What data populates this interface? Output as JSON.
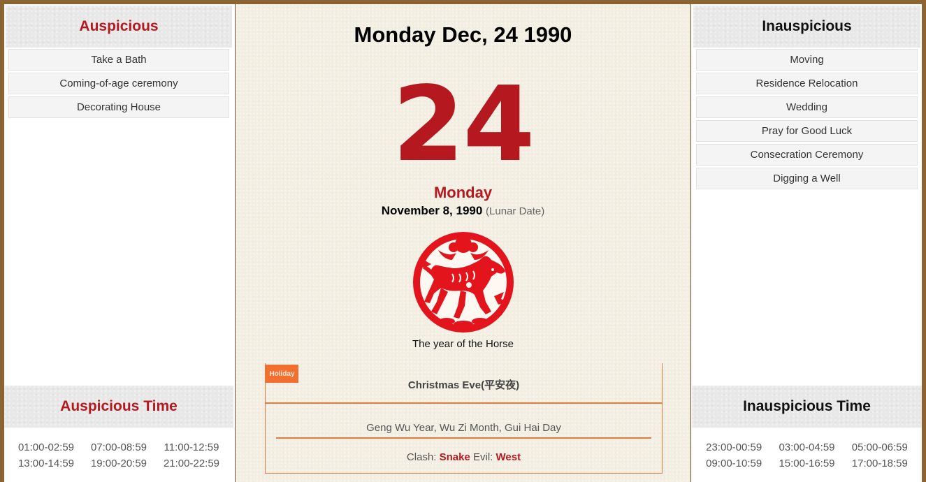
{
  "auspicious": {
    "title": "Auspicious",
    "items": [
      "Take a Bath",
      "Coming-of-age ceremony",
      "Decorating House"
    ]
  },
  "inauspicious": {
    "title": "Inauspicious",
    "items": [
      "Moving",
      "Residence Relocation",
      "Wedding",
      "Pray for Good Luck",
      "Consecration Ceremony",
      "Digging a Well"
    ]
  },
  "auspicious_time": {
    "title": "Auspicious Time",
    "slots": [
      "01:00-02:59",
      "07:00-08:59",
      "11:00-12:59",
      "13:00-14:59",
      "19:00-20:59",
      "21:00-22:59"
    ]
  },
  "inauspicious_time": {
    "title": "Inauspicious Time",
    "slots": [
      "23:00-00:59",
      "03:00-04:59",
      "05:00-06:59",
      "09:00-10:59",
      "15:00-16:59",
      "17:00-18:59"
    ]
  },
  "center": {
    "date_title": "Monday Dec, 24 1990",
    "day_number": "24",
    "weekday": "Monday",
    "lunar_date": "November 8, 1990",
    "lunar_label": "(Lunar Date)",
    "zodiac_icon": "horse-papercut-icon",
    "zodiac_caption": "The year of the Horse",
    "holiday_badge": "Holiday",
    "holiday_name": "Christmas Eve(平安夜)",
    "ganzhi": "Geng Wu Year, Wu Zi Month, Gui Hai Day",
    "clash_label": "Clash:",
    "clash_value": "Snake",
    "evil_label": "Evil:",
    "evil_value": "West"
  },
  "colors": {
    "frame": "#8c6333",
    "accent_red": "#b5191f",
    "badge_orange": "#f26f30",
    "divider_orange": "#e07b44",
    "paper": "#f3eee2"
  }
}
